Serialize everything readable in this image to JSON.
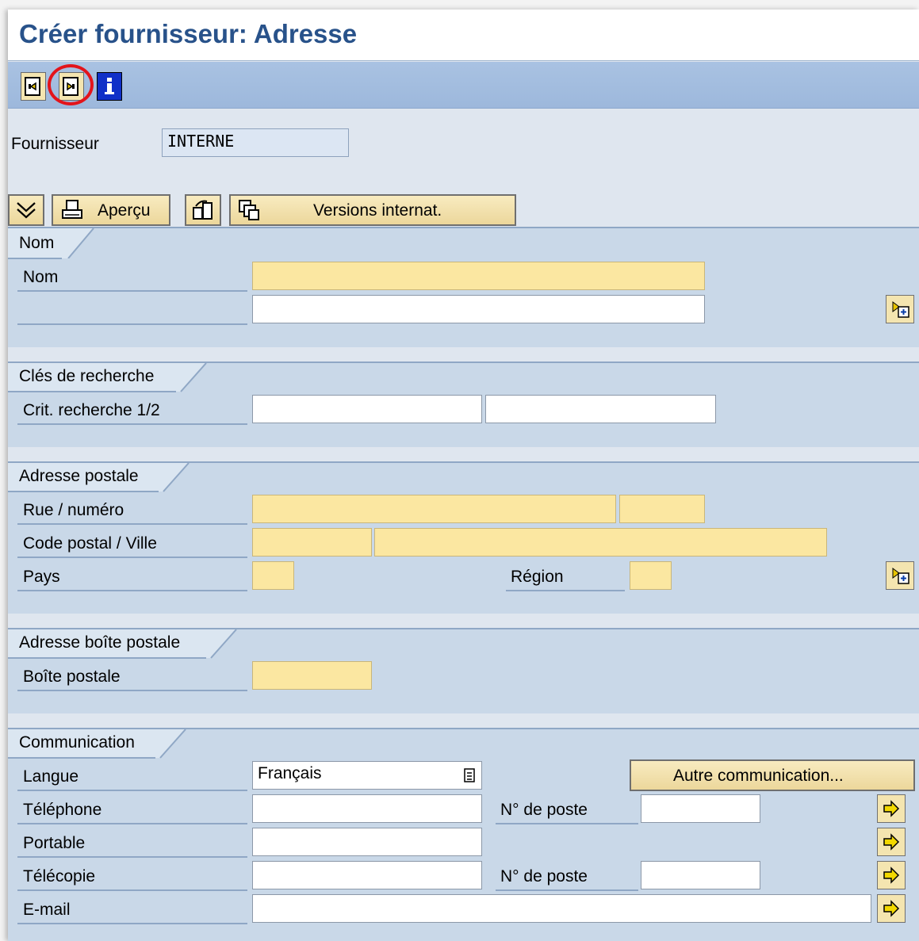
{
  "window": {
    "title": "Créer fournisseur: Adresse"
  },
  "toolbar": {
    "icons": [
      "previous-screen-icon",
      "next-screen-icon",
      "info-icon"
    ]
  },
  "supplier": {
    "label": "Fournisseur",
    "value": "INTERNE"
  },
  "actions": {
    "preview_label": "Aperçu",
    "intl_versions_label": "Versions internat."
  },
  "sections": {
    "name": {
      "title": "Nom",
      "name_label": "Nom"
    },
    "search": {
      "title": "Clés de recherche",
      "crit_label": "Crit. recherche 1/2"
    },
    "postal": {
      "title": "Adresse postale",
      "street_label": "Rue / numéro",
      "city_label": "Code postal / Ville",
      "country_label": "Pays",
      "region_label": "Région"
    },
    "pobox": {
      "title": "Adresse boîte postale",
      "pobox_label": "Boîte postale"
    },
    "comm": {
      "title": "Communication",
      "language_label": "Langue",
      "language_value": "Français",
      "other_comm_label": "Autre communication...",
      "phone_label": "Téléphone",
      "ext_label": "N° de poste",
      "mobile_label": "Portable",
      "fax_label": "Télécopie",
      "fax_ext_label": "N° de poste",
      "email_label": "E-mail"
    }
  },
  "colors": {
    "title": "#28528a",
    "required_field": "#fbe7a1",
    "section_bg": "#c9d8e8",
    "highlight_circle": "#e3141b"
  }
}
